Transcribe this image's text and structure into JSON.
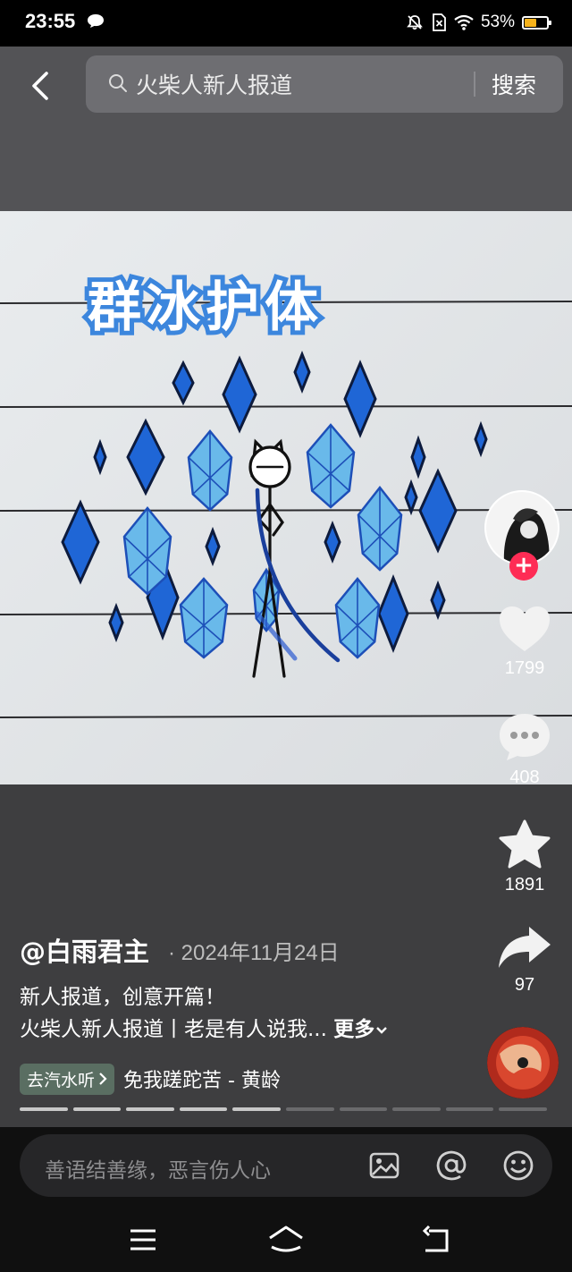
{
  "status_bar": {
    "time": "23:55",
    "battery": "53%",
    "battery_level": 0.53
  },
  "search": {
    "query": "火柴人新人报道",
    "button_label": "搜索"
  },
  "video": {
    "overlay_title": "群冰护体"
  },
  "actions": {
    "likes": "1799",
    "comments": "408",
    "favorites": "1891",
    "shares": "97"
  },
  "post": {
    "author": "@白雨君主",
    "date": "· 2024年11月24日",
    "line1": "新人报道，创意开篇！",
    "line2": "火柴人新人报道丨老是有人说我...",
    "more_label": "更多",
    "music_tag": "去汽水听",
    "music_title": "免我蹉跎苦 - 黄龄",
    "progress_segments": 10,
    "progress_done": 5
  },
  "comment_input": {
    "placeholder": "善语结善缘，恶言伤人心"
  },
  "colors": {
    "accent_red": "#fe2c55",
    "battery": "#f6b21b",
    "ice_blue": "#1f66d6"
  }
}
